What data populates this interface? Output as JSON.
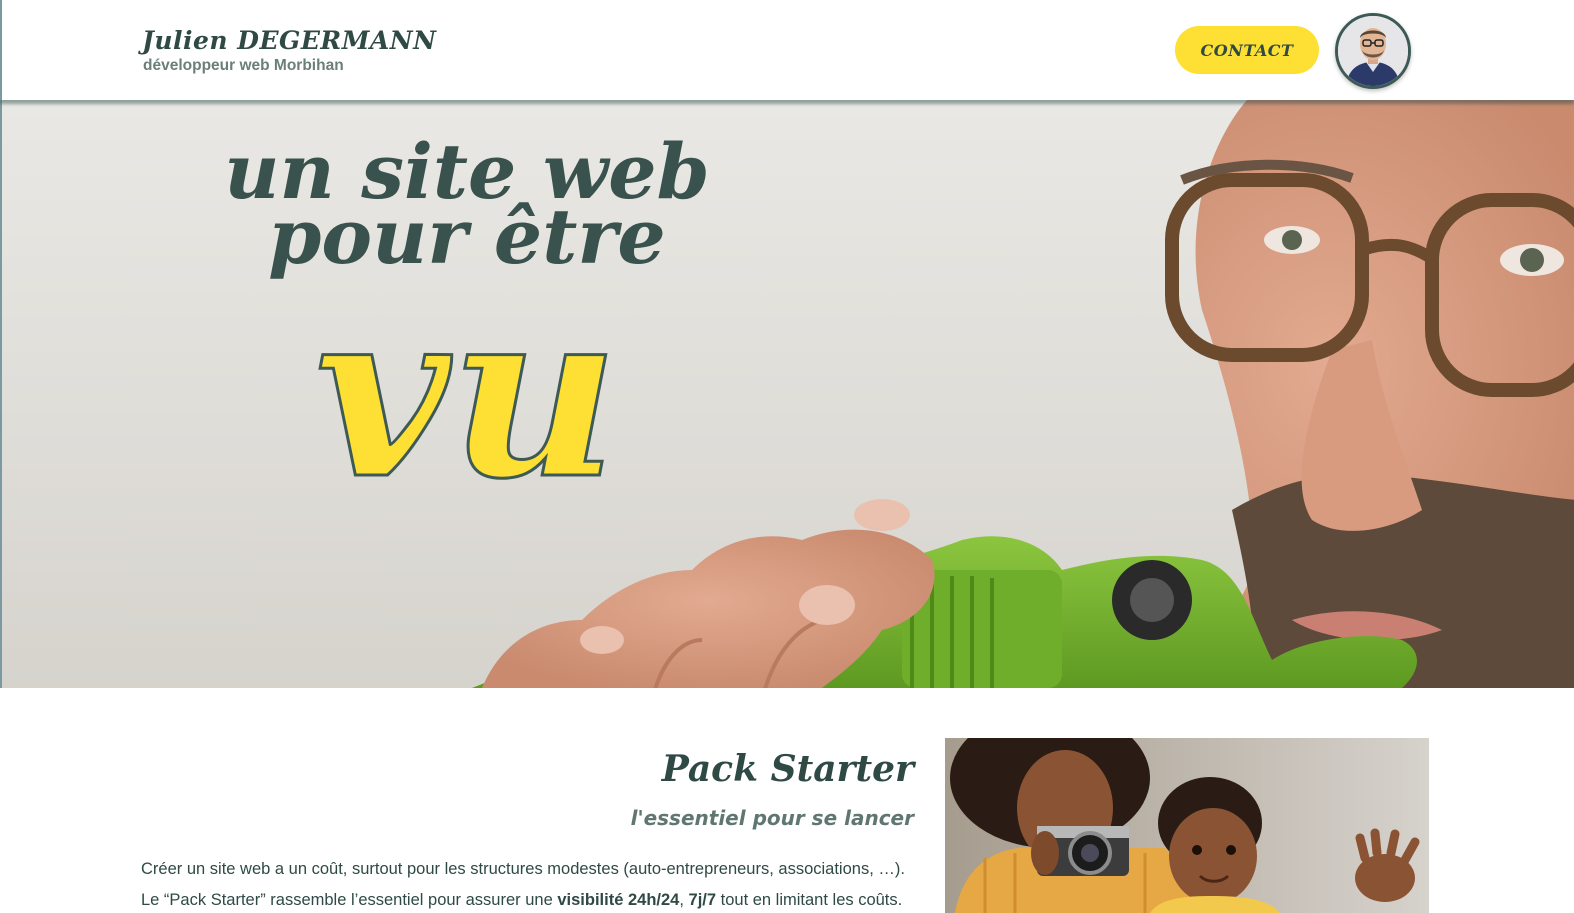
{
  "header": {
    "brand_name": "Julien DEGERMANN",
    "brand_tagline": "développeur web Morbihan",
    "contact_label": "CONTACT"
  },
  "hero": {
    "line1": "un site web",
    "line2": "pour être",
    "highlight": "vu"
  },
  "pack": {
    "title": "Pack Starter",
    "subtitle": "l'essentiel pour se lancer",
    "paragraph1": "Créer un site web a un coût, surtout pour les structures modestes (auto-entrepreneurs, associations, …).",
    "paragraph2_part1": "Le “Pack Starter” rassemble l’essentiel pour assurer une ",
    "paragraph2_bold1": "visibilité 24h/24",
    "paragraph2_sep": ", ",
    "paragraph2_bold2": "7j/7",
    "paragraph2_part2": " tout en limitant les coûts."
  },
  "colors": {
    "accent_yellow": "#fde033",
    "text_dark": "#2f4a45",
    "binocular_green": "#7cb832"
  },
  "icons": [
    "avatar-photo"
  ]
}
